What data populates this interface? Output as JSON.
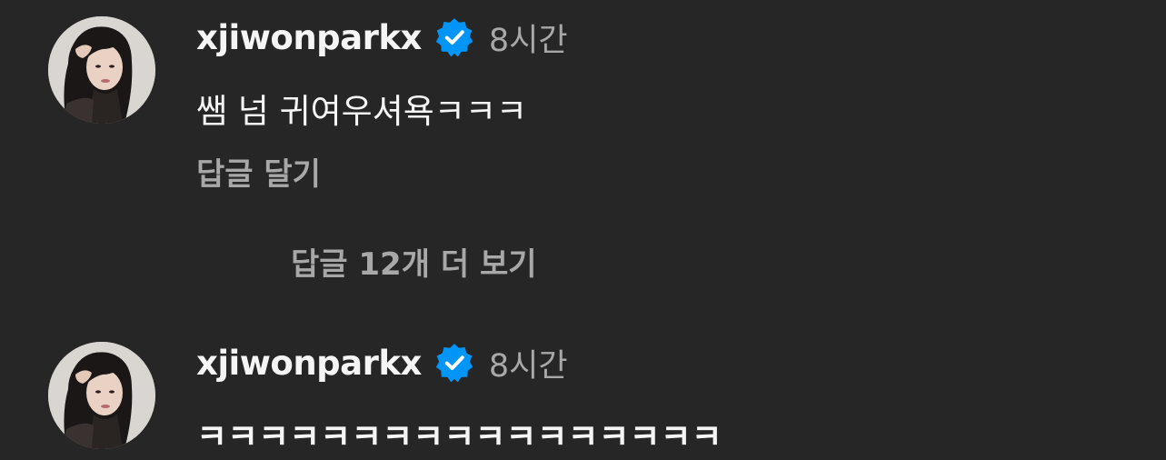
{
  "comments": [
    {
      "username": "xjiwonparkx",
      "verified_icon": "verified-badge-icon",
      "timestamp": "8시간",
      "text": "쌤 넘 귀여우셔욕ㅋㅋㅋ",
      "reply_label": "답글 달기"
    },
    {
      "username": "xjiwonparkx",
      "verified_icon": "verified-badge-icon",
      "timestamp": "8시간",
      "text": "ㅋㅋㅋㅋㅋㅋㅋㅋㅋㅋㅋㅋㅋㅋㅋㅋㅋ"
    }
  ],
  "more_replies_label": "답글 12개 더 보기",
  "colors": {
    "background": "#262626",
    "primary_text": "#f5f5f5",
    "secondary_text": "#a8a8a8",
    "verified_blue": "#0095f6"
  }
}
